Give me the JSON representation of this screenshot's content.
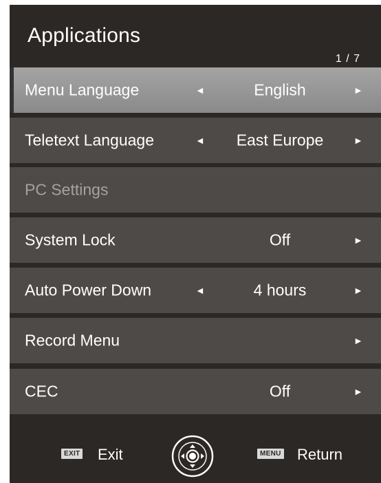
{
  "header": {
    "title": "Applications",
    "page_indicator": "1 / 7"
  },
  "rows": [
    {
      "label": "Menu Language",
      "value": "English",
      "left_arrow": "◄",
      "right_arrow": "►",
      "state": "selected"
    },
    {
      "label": "Teletext Language",
      "value": "East Europe",
      "left_arrow": "◄",
      "right_arrow": "►",
      "state": "normal"
    },
    {
      "label": "PC Settings",
      "value": "",
      "left_arrow": "",
      "right_arrow": "",
      "state": "disabled"
    },
    {
      "label": "System Lock",
      "value": "Off",
      "left_arrow": "",
      "right_arrow": "►",
      "state": "normal"
    },
    {
      "label": "Auto Power Down",
      "value": "4 hours",
      "left_arrow": "◄",
      "right_arrow": "►",
      "state": "normal"
    },
    {
      "label": "Record Menu",
      "value": "",
      "left_arrow": "",
      "right_arrow": "►",
      "state": "normal"
    },
    {
      "label": "CEC",
      "value": "Off",
      "left_arrow": "",
      "right_arrow": "►",
      "state": "normal"
    }
  ],
  "footer": {
    "exit_key": "EXIT",
    "exit_label": "Exit",
    "nav_icon": "navigation-pad-icon",
    "menu_key": "MENU",
    "return_label": "Return"
  },
  "colors": {
    "background": "#2b2825",
    "row": "#4d4a47",
    "selected_row": "#9a9a9a",
    "disabled_text": "#a5a3a0",
    "text": "#ffffff"
  }
}
